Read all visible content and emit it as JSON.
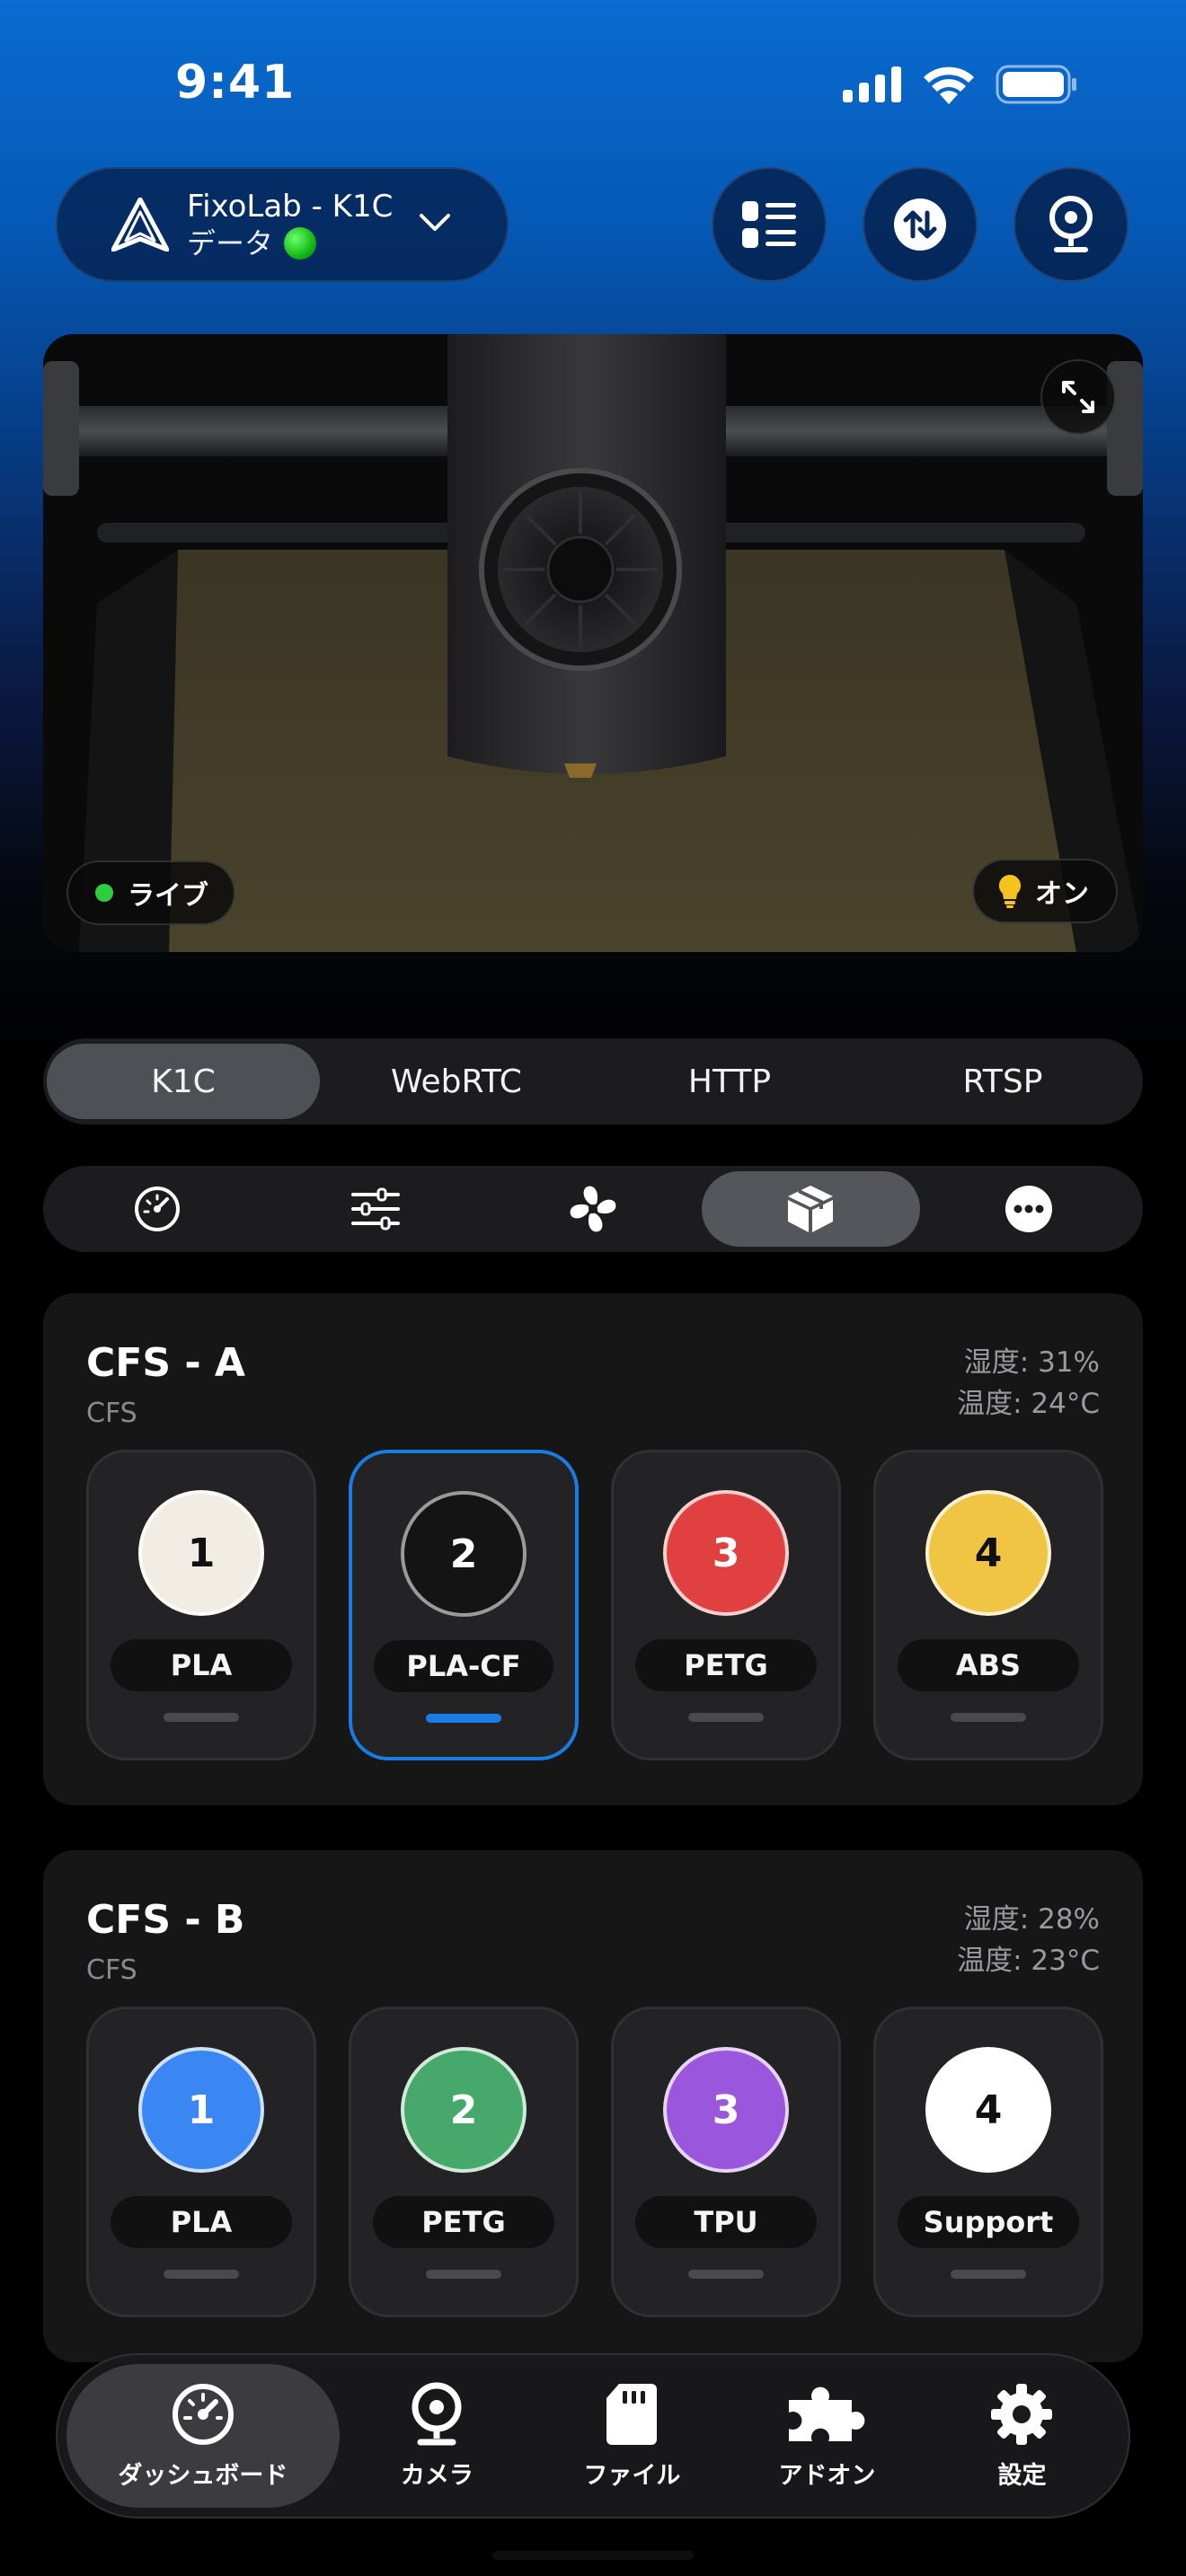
{
  "status_bar": {
    "time": "9:41"
  },
  "header": {
    "printer_name": "FixoLab - K1C",
    "printer_sub": "データ",
    "buttons": [
      "list-icon",
      "transfer-icon",
      "webcam-icon"
    ]
  },
  "camera": {
    "live_label": "ライブ",
    "light_label": "オン"
  },
  "stream_tabs": {
    "items": [
      "K1C",
      "WebRTC",
      "HTTP",
      "RTSP"
    ],
    "selected": "K1C"
  },
  "section_tabs": {
    "icons": [
      "gauge-icon",
      "sliders-icon",
      "fan-icon",
      "box-icon",
      "more-icon"
    ],
    "selected": "box-icon"
  },
  "cfs": [
    {
      "title": "CFS - A",
      "subtitle": "CFS",
      "humidity": "湿度: 31%",
      "temperature": "温度: 24°C",
      "slots": [
        {
          "number": "1",
          "material": "PLA",
          "color": "#f1ede4",
          "text_color": "#111111",
          "selected": false
        },
        {
          "number": "2",
          "material": "PLA-CF",
          "color": "#141414",
          "text_color": "#ffffff",
          "selected": true
        },
        {
          "number": "3",
          "material": "PETG",
          "color": "#e0403f",
          "text_color": "#ffffff",
          "selected": false
        },
        {
          "number": "4",
          "material": "ABS",
          "color": "#f0c543",
          "text_color": "#111111",
          "selected": false
        }
      ]
    },
    {
      "title": "CFS - B",
      "subtitle": "CFS",
      "humidity": "湿度: 28%",
      "temperature": "温度: 23°C",
      "slots": [
        {
          "number": "1",
          "material": "PLA",
          "color": "#3a86f2",
          "text_color": "#ffffff",
          "selected": false
        },
        {
          "number": "2",
          "material": "PETG",
          "color": "#46a86a",
          "text_color": "#ffffff",
          "selected": false
        },
        {
          "number": "3",
          "material": "TPU",
          "color": "#9a56dc",
          "text_color": "#ffffff",
          "selected": false
        },
        {
          "number": "4",
          "material": "Support",
          "color": "#ffffff",
          "text_color": "#111111",
          "selected": false
        }
      ]
    }
  ],
  "bottom_nav": {
    "items": [
      {
        "label": "ダッシュボード",
        "icon": "dashboard-icon"
      },
      {
        "label": "カメラ",
        "icon": "camera-icon"
      },
      {
        "label": "ファイル",
        "icon": "sd-card-icon"
      },
      {
        "label": "アドオン",
        "icon": "puzzle-icon"
      },
      {
        "label": "設定",
        "icon": "gear-icon"
      }
    ],
    "selected": "ダッシュボード"
  }
}
